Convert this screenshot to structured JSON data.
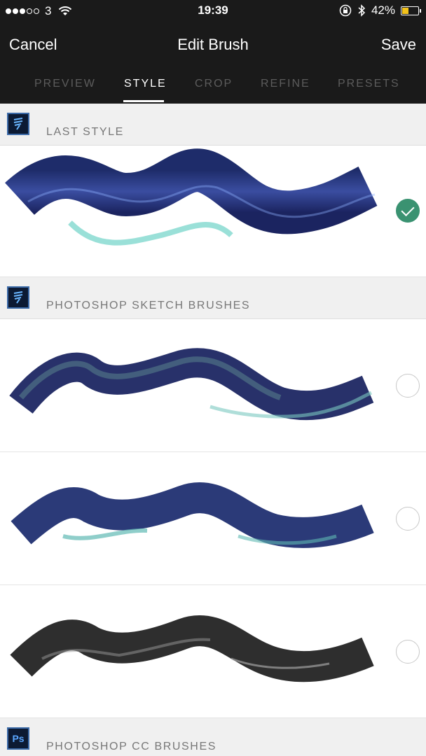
{
  "status_bar": {
    "carrier": "3",
    "time": "19:39",
    "battery": "42%",
    "battery_level": 0.42,
    "battery_color": "#f2c21b"
  },
  "nav": {
    "cancel_label": "Cancel",
    "title": "Edit Brush",
    "save_label": "Save"
  },
  "tabs": [
    {
      "label": "PREVIEW",
      "active": false
    },
    {
      "label": "STYLE",
      "active": true
    },
    {
      "label": "CROP",
      "active": false
    },
    {
      "label": "REFINE",
      "active": false
    },
    {
      "label": "PRESETS",
      "active": false
    }
  ],
  "sections": [
    {
      "label": "LAST STYLE",
      "icon": "sketch-brush-icon"
    },
    {
      "label": "PHOTOSHOP SKETCH BRUSHES",
      "icon": "sketch-brush-icon"
    },
    {
      "label": "PHOTOSHOP CC BRUSHES",
      "icon": "photoshop-icon",
      "icon_text": "Ps"
    }
  ],
  "brushes": [
    {
      "style": "Last style",
      "selected": true,
      "color": "#2a3675",
      "accent": "#6fd3c8"
    },
    {
      "style": "Sketch brush 1",
      "selected": false,
      "color": "#28316a",
      "accent": "#3f6d7a"
    },
    {
      "style": "Sketch brush 2",
      "selected": false,
      "color": "#2b3a78",
      "accent": "#5fb9b3"
    },
    {
      "style": "Sketch brush 3",
      "selected": false,
      "color": "#2e2e2e",
      "accent": "#9a9a9a"
    }
  ],
  "colors": {
    "header_bg": "#1a1a1a",
    "section_bg": "#f0f0f0",
    "check_green": "#3a9271"
  }
}
